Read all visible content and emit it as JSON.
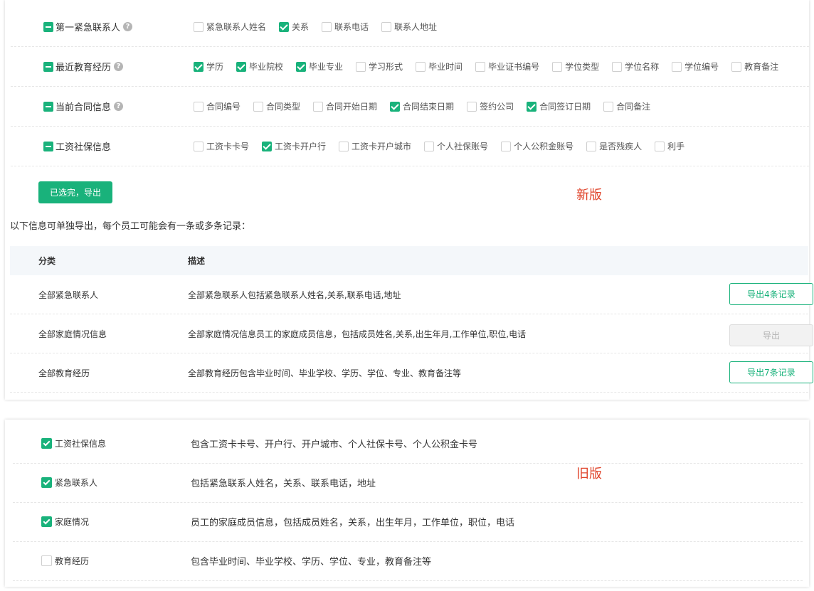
{
  "new_version": {
    "groups": [
      {
        "label": "第一紧急联系人",
        "help": "?",
        "options": [
          {
            "label": "紧急联系人姓名",
            "checked": false
          },
          {
            "label": "关系",
            "checked": true
          },
          {
            "label": "联系电话",
            "checked": false
          },
          {
            "label": "联系人地址",
            "checked": false
          }
        ]
      },
      {
        "label": "最近教育经历",
        "help": "?",
        "options": [
          {
            "label": "学历",
            "checked": true
          },
          {
            "label": "毕业院校",
            "checked": true
          },
          {
            "label": "毕业专业",
            "checked": true
          },
          {
            "label": "学习形式",
            "checked": false
          },
          {
            "label": "毕业时间",
            "checked": false
          },
          {
            "label": "毕业证书编号",
            "checked": false
          },
          {
            "label": "学位类型",
            "checked": false
          },
          {
            "label": "学位名称",
            "checked": false
          },
          {
            "label": "学位编号",
            "checked": false
          },
          {
            "label": "教育备注",
            "checked": false
          }
        ]
      },
      {
        "label": "当前合同信息",
        "help": "?",
        "options": [
          {
            "label": "合同编号",
            "checked": false
          },
          {
            "label": "合同类型",
            "checked": false
          },
          {
            "label": "合同开始日期",
            "checked": false
          },
          {
            "label": "合同结束日期",
            "checked": true
          },
          {
            "label": "签约公司",
            "checked": false
          },
          {
            "label": "合同签订日期",
            "checked": true
          },
          {
            "label": "合同备注",
            "checked": false
          }
        ]
      },
      {
        "label": "工资社保信息",
        "options": [
          {
            "label": "工资卡卡号",
            "checked": false
          },
          {
            "label": "工资卡开户行",
            "checked": true
          },
          {
            "label": "工资卡开户城市",
            "checked": false
          },
          {
            "label": "个人社保账号",
            "checked": false
          },
          {
            "label": "个人公积金账号",
            "checked": false
          },
          {
            "label": "是否残疾人",
            "checked": false
          },
          {
            "label": "利手",
            "checked": false
          }
        ]
      }
    ],
    "export_button": "已选完，导出",
    "tag": "新版",
    "note": "以下信息可单独导出，每个员工可能会有一条或多条记录：",
    "table": {
      "headers": [
        "分类",
        "描述"
      ],
      "rows": [
        {
          "category": "全部紧急联系人",
          "desc": "全部紧急联系人包括紧急联系人姓名,关系,联系电话,地址",
          "button": "导出4条记录",
          "disabled": false
        },
        {
          "category": "全部家庭情况信息",
          "desc": "全部家庭情况信息员工的家庭成员信息，包括成员姓名,关系,出生年月,工作单位,职位,电话",
          "button": "导出",
          "disabled": true
        },
        {
          "category": "全部教育经历",
          "desc": "全部教育经历包含毕业时间、毕业学校、学历、学位、专业、教育备注等",
          "button": "导出7条记录",
          "disabled": false
        }
      ]
    }
  },
  "old_version": {
    "tag": "旧版",
    "rows": [
      {
        "label": "工资社保信息",
        "checked": true,
        "desc": "包含工资卡卡号、开户行、开户城市、个人社保卡号、个人公积金卡号"
      },
      {
        "label": "紧急联系人",
        "checked": true,
        "desc": "包括紧急联系人姓名，关系、联系电话，地址"
      },
      {
        "label": "家庭情况",
        "checked": true,
        "desc": "员工的家庭成员信息，包括成员姓名，关系，出生年月，工作单位，职位，电话"
      },
      {
        "label": "教育经历",
        "checked": false,
        "desc": "包含毕业时间、毕业学校、学历、学位、专业，教育备注等"
      }
    ]
  }
}
